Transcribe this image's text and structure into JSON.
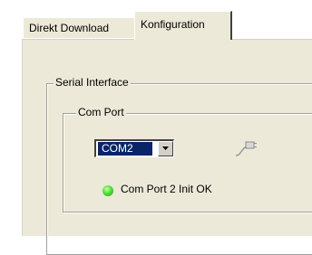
{
  "tabs": [
    {
      "label": "Direkt Download",
      "active": false
    },
    {
      "label": "Konfiguration",
      "active": true
    }
  ],
  "groups": {
    "serial_interface": "Serial Interface",
    "com_port": "Com Port"
  },
  "com_select": {
    "value": "COM2"
  },
  "status": {
    "text": "Com Port 2 Init OK",
    "led_color": "#2ecc1f"
  },
  "icons": {
    "connection": "plug-icon"
  },
  "colors": {
    "panel": "#ece9d8",
    "selection": "#0a246a"
  }
}
